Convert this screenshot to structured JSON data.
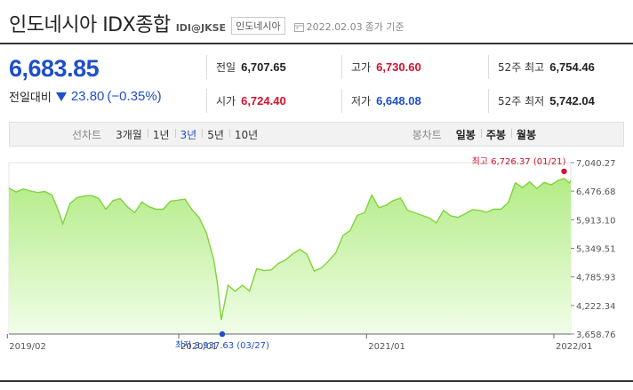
{
  "header": {
    "title": "인도네시아 IDX종합",
    "code": "IDI@JKSE",
    "market": "인도네시아",
    "date": "2022.02.03",
    "date_note": "종가 기준",
    "icon": "calendar-icon"
  },
  "price": {
    "current": "6,683.85",
    "change_label": "전일대비",
    "change": "23.80",
    "change_pct": "(−0.35%)",
    "direction": "down"
  },
  "stats": {
    "prev_close": {
      "label": "전일",
      "value": "6,707.65"
    },
    "open": {
      "label": "시가",
      "value": "6,724.40"
    },
    "high": {
      "label": "고가",
      "value": "6,730.60"
    },
    "low": {
      "label": "저가",
      "value": "6,648.08"
    },
    "w52_high": {
      "label": "52주 최고",
      "value": "6,754.46"
    },
    "w52_low": {
      "label": "52주 최저",
      "value": "5,742.04"
    }
  },
  "toolbar": {
    "line_label": "선차트",
    "line_periods": [
      "3개월",
      "1년",
      "3년",
      "5년",
      "10년"
    ],
    "active_period": "3년",
    "candle_label": "봉차트",
    "candle_periods": [
      "일봉",
      "주봉",
      "월봉"
    ]
  },
  "colors": {
    "up": "#d4112f",
    "down": "#1f4fc9",
    "line": "#7fd43a",
    "fill_top": "#b3ec86",
    "fill_bottom": "#f1fde8"
  },
  "chart_data": {
    "type": "area",
    "x_start": "2019-02-04",
    "x_end": "2022-02-03",
    "x_ticks": [
      {
        "date": "2019-02-01",
        "label": "2019/02"
      },
      {
        "date": "2020-01-01",
        "label": "2020/01"
      },
      {
        "date": "2021-01-01",
        "label": "2021/01"
      },
      {
        "date": "2022-01-01",
        "label": "2022/01"
      }
    ],
    "y_ticks": [
      "7,040.27",
      "6,476.68",
      "5,913.10",
      "5,349.51",
      "4,785.93",
      "4,222.34",
      "3,658.76"
    ],
    "ylim": [
      3658.76,
      7040.27
    ],
    "grid": false,
    "series": [
      {
        "values": [
          [
            "2019-02-04",
            6540
          ],
          [
            "2019-02-18",
            6460
          ],
          [
            "2019-03-04",
            6520
          ],
          [
            "2019-03-18",
            6480
          ],
          [
            "2019-04-01",
            6450
          ],
          [
            "2019-04-15",
            6470
          ],
          [
            "2019-04-29",
            6400
          ],
          [
            "2019-05-13",
            6050
          ],
          [
            "2019-05-20",
            5830
          ],
          [
            "2019-06-03",
            6230
          ],
          [
            "2019-06-17",
            6350
          ],
          [
            "2019-07-01",
            6380
          ],
          [
            "2019-07-15",
            6390
          ],
          [
            "2019-07-29",
            6330
          ],
          [
            "2019-08-12",
            6120
          ],
          [
            "2019-08-26",
            6290
          ],
          [
            "2019-09-09",
            6330
          ],
          [
            "2019-09-23",
            6170
          ],
          [
            "2019-10-07",
            6050
          ],
          [
            "2019-10-21",
            6260
          ],
          [
            "2019-11-04",
            6170
          ],
          [
            "2019-11-18",
            6120
          ],
          [
            "2019-12-02",
            6120
          ],
          [
            "2019-12-16",
            6280
          ],
          [
            "2019-12-30",
            6300
          ],
          [
            "2020-01-13",
            6320
          ],
          [
            "2020-01-27",
            6110
          ],
          [
            "2020-02-10",
            5950
          ],
          [
            "2020-02-24",
            5650
          ],
          [
            "2020-03-09",
            5130
          ],
          [
            "2020-03-16",
            4690
          ],
          [
            "2020-03-24",
            3937.63
          ],
          [
            "2020-04-06",
            4620
          ],
          [
            "2020-04-20",
            4500
          ],
          [
            "2020-05-04",
            4620
          ],
          [
            "2020-05-18",
            4510
          ],
          [
            "2020-06-01",
            4950
          ],
          [
            "2020-06-15",
            4910
          ],
          [
            "2020-06-29",
            4920
          ],
          [
            "2020-07-13",
            5050
          ],
          [
            "2020-07-27",
            5120
          ],
          [
            "2020-08-10",
            5240
          ],
          [
            "2020-08-24",
            5330
          ],
          [
            "2020-09-07",
            5230
          ],
          [
            "2020-09-21",
            4900
          ],
          [
            "2020-10-05",
            4960
          ],
          [
            "2020-10-19",
            5100
          ],
          [
            "2020-11-02",
            5260
          ],
          [
            "2020-11-16",
            5600
          ],
          [
            "2020-11-30",
            5700
          ],
          [
            "2020-12-14",
            6000
          ],
          [
            "2020-12-28",
            6050
          ],
          [
            "2021-01-11",
            6400
          ],
          [
            "2021-01-25",
            6150
          ],
          [
            "2021-02-08",
            6200
          ],
          [
            "2021-02-22",
            6290
          ],
          [
            "2021-03-08",
            6340
          ],
          [
            "2021-03-22",
            6100
          ],
          [
            "2021-04-05",
            6050
          ],
          [
            "2021-04-19",
            6000
          ],
          [
            "2021-05-03",
            5950
          ],
          [
            "2021-05-17",
            5850
          ],
          [
            "2021-05-31",
            6100
          ],
          [
            "2021-06-14",
            5990
          ],
          [
            "2021-06-28",
            5960
          ],
          [
            "2021-07-12",
            6030
          ],
          [
            "2021-07-26",
            6110
          ],
          [
            "2021-08-09",
            6100
          ],
          [
            "2021-08-23",
            6060
          ],
          [
            "2021-09-06",
            6120
          ],
          [
            "2021-09-20",
            6120
          ],
          [
            "2021-10-04",
            6250
          ],
          [
            "2021-10-18",
            6640
          ],
          [
            "2021-11-01",
            6550
          ],
          [
            "2021-11-15",
            6660
          ],
          [
            "2021-11-29",
            6530
          ],
          [
            "2021-12-13",
            6650
          ],
          [
            "2021-12-27",
            6600
          ],
          [
            "2022-01-10",
            6690
          ],
          [
            "2022-01-21",
            6726.37
          ],
          [
            "2022-01-31",
            6640
          ],
          [
            "2022-02-03",
            6683.85
          ]
        ]
      }
    ],
    "annotations": {
      "high": {
        "label": "최고",
        "value": "6,726.37",
        "date_label": "(01/21)",
        "date": "2022-01-21",
        "y": 6726.37
      },
      "low": {
        "label": "최저",
        "value": "3,937.63",
        "date_label": "(03/27)",
        "date": "2020-03-24",
        "y": 3937.63
      }
    }
  }
}
